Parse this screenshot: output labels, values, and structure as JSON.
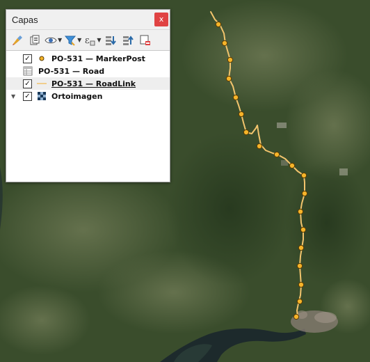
{
  "panel": {
    "title": "Capas",
    "close_label": "x"
  },
  "toolbar": {
    "buttons": [
      {
        "icon": "paint-style-icon"
      },
      {
        "icon": "add-group-icon"
      },
      {
        "icon": "visibility-eye-icon"
      },
      {
        "icon": "filter-funnel-icon"
      },
      {
        "icon": "filter-expression-icon"
      },
      {
        "icon": "expand-all-icon"
      },
      {
        "icon": "collapse-all-icon"
      },
      {
        "icon": "remove-layer-icon"
      }
    ]
  },
  "layers": [
    {
      "name": "PO-531 — MarkerPost",
      "checked": true,
      "type": "point"
    },
    {
      "name": "PO-531 — Road",
      "checked": null,
      "type": "table"
    },
    {
      "name": "PO-531 — RoadLink",
      "checked": true,
      "type": "line"
    },
    {
      "name": "Ortoimagen",
      "checked": true,
      "type": "raster",
      "expanded": true
    }
  ],
  "map": {
    "road_color": "#f2c46d",
    "marker_fill": "#f5b42a",
    "marker_stroke": "#5a3a00",
    "water_color": "#1d2a2c"
  }
}
